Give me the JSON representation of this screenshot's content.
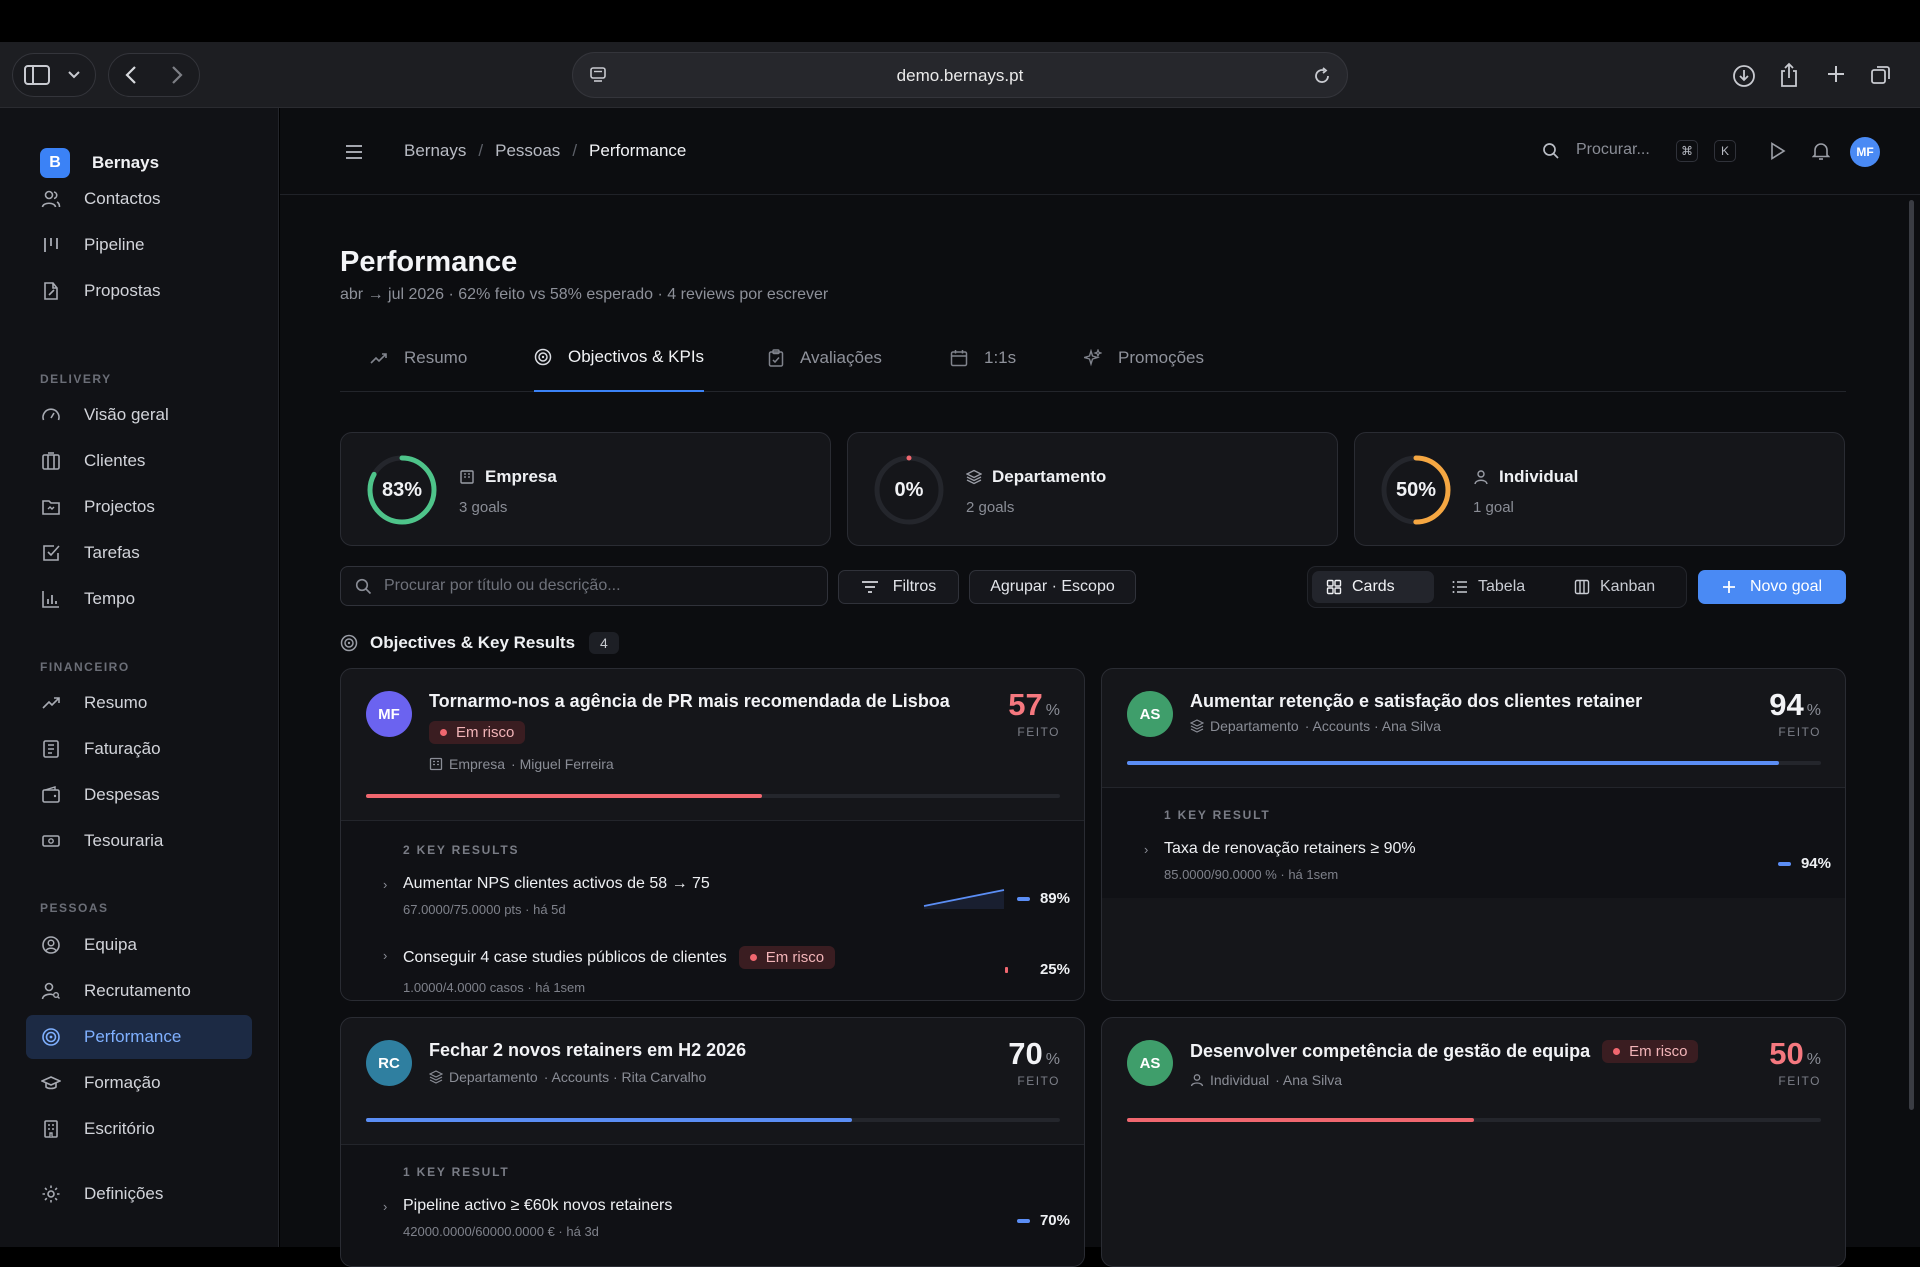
{
  "browser": {
    "url": "demo.bernays.pt"
  },
  "sidebar": {
    "brand": {
      "letter": "B",
      "name": "Bernays"
    },
    "top_items": [
      {
        "label": "Contactos"
      },
      {
        "label": "Pipeline"
      },
      {
        "label": "Propostas"
      }
    ],
    "sections": [
      {
        "title": "DELIVERY",
        "items": [
          {
            "label": "Visão geral"
          },
          {
            "label": "Clientes"
          },
          {
            "label": "Projectos"
          },
          {
            "label": "Tarefas"
          },
          {
            "label": "Tempo"
          }
        ]
      },
      {
        "title": "FINANCEIRO",
        "items": [
          {
            "label": "Resumo"
          },
          {
            "label": "Faturação"
          },
          {
            "label": "Despesas"
          },
          {
            "label": "Tesouraria"
          }
        ]
      },
      {
        "title": "PESSOAS",
        "items": [
          {
            "label": "Equipa"
          },
          {
            "label": "Recrutamento"
          },
          {
            "label": "Performance"
          },
          {
            "label": "Formação"
          },
          {
            "label": "Escritório"
          }
        ]
      }
    ],
    "settings": "Definições"
  },
  "header": {
    "breadcrumb": [
      "Bernays",
      "Pessoas",
      "Performance"
    ],
    "search_label": "Procurar...",
    "kbd": [
      "⌘",
      "K"
    ],
    "user_initials": "MF"
  },
  "page": {
    "title": "Performance",
    "subtitle": "abr → jul 2026 · 62% feito vs 58% esperado · 4 reviews por escrever"
  },
  "tabs": [
    {
      "label": "Resumo"
    },
    {
      "label": "Objectivos & KPIs"
    },
    {
      "label": "Avaliações"
    },
    {
      "label": "1:1s"
    },
    {
      "label": "Promoções"
    }
  ],
  "scopes": [
    {
      "label": "Empresa",
      "percent_text": "83%",
      "percent": 83,
      "goals": "3 goals",
      "color": "#4ec48a"
    },
    {
      "label": "Departamento",
      "percent_text": "0%",
      "percent": 0,
      "goals": "2 goals",
      "color": "#f0676f"
    },
    {
      "label": "Individual",
      "percent_text": "50%",
      "percent": 50,
      "goals": "1 goal",
      "color": "#f5a742"
    }
  ],
  "toolbar": {
    "search_placeholder": "Procurar por título ou descrição...",
    "filters": "Filtros",
    "group": "Agrupar · Escopo",
    "views": [
      {
        "label": "Cards"
      },
      {
        "label": "Tabela"
      },
      {
        "label": "Kanban"
      }
    ],
    "new_goal": "Novo goal"
  },
  "okr": {
    "title": "Objectives & Key Results",
    "count": "4"
  },
  "goals": [
    {
      "initials": "MF",
      "avatar_color": "#6b63f0",
      "title": "Tornarmo-nos a agência de PR mais recomendada de Lisboa",
      "risk": "Em risco",
      "scope": "Empresa",
      "owner": "· Miguel Ferreira",
      "percent_num": "57",
      "percent_sign": "%",
      "done": "FEITO",
      "progress": 57,
      "color": "#f0676f",
      "kr_header": "2 KEY RESULTS",
      "krs": [
        {
          "title": "Aumentar NPS clientes activos de 58 → 75",
          "meta": "67.0000/75.0000 pts · há 5d",
          "pct": "89%",
          "color": "#5b8ef5"
        },
        {
          "title": "Conseguir 4 case studies públicos de clientes",
          "risk": "Em risco",
          "meta": "1.0000/4.0000 casos · há 1sem",
          "pct": "25%",
          "color": "#f0676f"
        }
      ]
    },
    {
      "initials": "AS",
      "avatar_color": "#3f9e6b",
      "title": "Aumentar retenção e satisfação dos clientes retainer",
      "scope": "Departamento",
      "owner": "· Accounts · Ana Silva",
      "percent_num": "94",
      "percent_sign": "%",
      "done": "FEITO",
      "progress": 94,
      "color": "#5b8ef5",
      "kr_header": "1 KEY RESULT",
      "krs": [
        {
          "title": "Taxa de renovação retainers ≥ 90%",
          "meta": "85.0000/90.0000 % · há 1sem",
          "pct": "94%",
          "color": "#5b8ef5"
        }
      ]
    },
    {
      "initials": "RC",
      "avatar_color": "#2f7fa0",
      "title": "Fechar 2 novos retainers em H2 2026",
      "scope": "Departamento",
      "owner": "· Accounts · Rita Carvalho",
      "percent_num": "70",
      "percent_sign": "%",
      "done": "FEITO",
      "progress": 70,
      "color": "#5b8ef5",
      "kr_header": "1 KEY RESULT",
      "krs": [
        {
          "title": "Pipeline activo ≥ €60k novos retainers",
          "meta": "42000.0000/60000.0000 € · há 3d",
          "pct": "70%",
          "color": "#5b8ef5"
        }
      ]
    },
    {
      "initials": "AS",
      "avatar_color": "#3f9e6b",
      "title": "Desenvolver competência de gestão de equipa",
      "risk": "Em risco",
      "scope": "Individual",
      "owner": "· Ana Silva",
      "percent_num": "50",
      "percent_sign": "%",
      "done": "FEITO",
      "progress": 50,
      "color": "#f0676f"
    }
  ],
  "colors": {
    "accent": "#3b82f6",
    "risk": "#f0676f",
    "success": "#4ec48a",
    "warning": "#f5a742"
  }
}
